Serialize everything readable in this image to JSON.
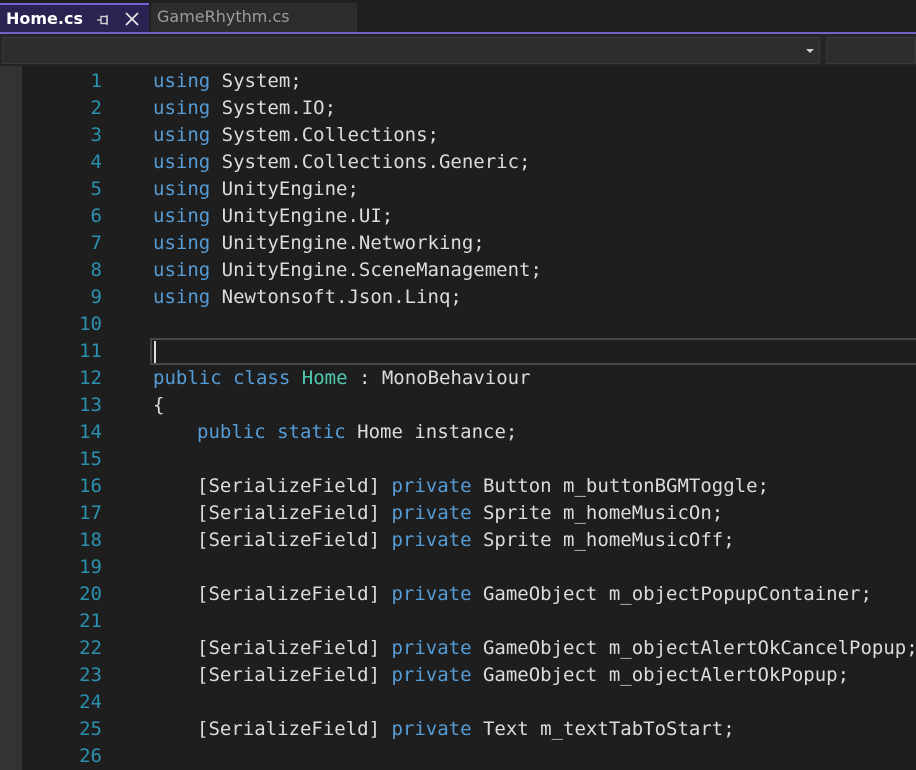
{
  "tabs": [
    {
      "label": "Home.cs",
      "active": true
    },
    {
      "label": "GameRhythm.cs",
      "active": false
    }
  ],
  "icons": {
    "pin": "pin-icon",
    "close": "close-icon",
    "dropdown": "chevron-down-icon"
  },
  "colors": {
    "accent": "#7160c6",
    "keyword": "#569cd6",
    "type": "#4ec9b0",
    "text": "#dcdcdc",
    "line_number": "#2b91af"
  },
  "editor": {
    "current_line": 11,
    "lines": [
      {
        "num": "1",
        "indent": 0,
        "tokens": [
          {
            "t": "using",
            "c": "kw"
          },
          {
            "t": " System;",
            "c": ""
          }
        ]
      },
      {
        "num": "2",
        "indent": 0,
        "tokens": [
          {
            "t": "using",
            "c": "kw"
          },
          {
            "t": " System.IO;",
            "c": ""
          }
        ]
      },
      {
        "num": "3",
        "indent": 0,
        "tokens": [
          {
            "t": "using",
            "c": "kw"
          },
          {
            "t": " System.Collections;",
            "c": ""
          }
        ]
      },
      {
        "num": "4",
        "indent": 0,
        "tokens": [
          {
            "t": "using",
            "c": "kw"
          },
          {
            "t": " System.Collections.Generic;",
            "c": ""
          }
        ]
      },
      {
        "num": "5",
        "indent": 0,
        "tokens": [
          {
            "t": "using",
            "c": "kw"
          },
          {
            "t": " UnityEngine;",
            "c": ""
          }
        ]
      },
      {
        "num": "6",
        "indent": 0,
        "tokens": [
          {
            "t": "using",
            "c": "kw"
          },
          {
            "t": " UnityEngine.UI;",
            "c": ""
          }
        ]
      },
      {
        "num": "7",
        "indent": 0,
        "tokens": [
          {
            "t": "using",
            "c": "kw"
          },
          {
            "t": " UnityEngine.Networking;",
            "c": ""
          }
        ]
      },
      {
        "num": "8",
        "indent": 0,
        "tokens": [
          {
            "t": "using",
            "c": "kw"
          },
          {
            "t": " UnityEngine.SceneManagement;",
            "c": ""
          }
        ]
      },
      {
        "num": "9",
        "indent": 0,
        "tokens": [
          {
            "t": "using",
            "c": "kw"
          },
          {
            "t": " Newtonsoft.Json.Linq;",
            "c": ""
          }
        ]
      },
      {
        "num": "10",
        "indent": 0,
        "tokens": []
      },
      {
        "num": "11",
        "indent": 0,
        "tokens": []
      },
      {
        "num": "12",
        "indent": 0,
        "tokens": [
          {
            "t": "public",
            "c": "kw"
          },
          {
            "t": " ",
            "c": ""
          },
          {
            "t": "class",
            "c": "kw"
          },
          {
            "t": " ",
            "c": ""
          },
          {
            "t": "Home",
            "c": "ty"
          },
          {
            "t": " : MonoBehaviour",
            "c": ""
          }
        ]
      },
      {
        "num": "13",
        "indent": 0,
        "tokens": [
          {
            "t": "{",
            "c": ""
          }
        ]
      },
      {
        "num": "14",
        "indent": 1,
        "tokens": [
          {
            "t": "public",
            "c": "kw"
          },
          {
            "t": " ",
            "c": ""
          },
          {
            "t": "static",
            "c": "kw"
          },
          {
            "t": " Home instance;",
            "c": ""
          }
        ]
      },
      {
        "num": "15",
        "indent": 1,
        "tokens": []
      },
      {
        "num": "16",
        "indent": 1,
        "tokens": [
          {
            "t": "[SerializeField] ",
            "c": ""
          },
          {
            "t": "private",
            "c": "kw"
          },
          {
            "t": " Button m_buttonBGMToggle;",
            "c": ""
          }
        ]
      },
      {
        "num": "17",
        "indent": 1,
        "tokens": [
          {
            "t": "[SerializeField] ",
            "c": ""
          },
          {
            "t": "private",
            "c": "kw"
          },
          {
            "t": " Sprite m_homeMusicOn;",
            "c": ""
          }
        ]
      },
      {
        "num": "18",
        "indent": 1,
        "tokens": [
          {
            "t": "[SerializeField] ",
            "c": ""
          },
          {
            "t": "private",
            "c": "kw"
          },
          {
            "t": " Sprite m_homeMusicOff;",
            "c": ""
          }
        ]
      },
      {
        "num": "19",
        "indent": 1,
        "tokens": []
      },
      {
        "num": "20",
        "indent": 1,
        "tokens": [
          {
            "t": "[SerializeField] ",
            "c": ""
          },
          {
            "t": "private",
            "c": "kw"
          },
          {
            "t": " GameObject m_objectPopupContainer;",
            "c": ""
          }
        ]
      },
      {
        "num": "21",
        "indent": 1,
        "tokens": []
      },
      {
        "num": "22",
        "indent": 1,
        "tokens": [
          {
            "t": "[SerializeField] ",
            "c": ""
          },
          {
            "t": "private",
            "c": "kw"
          },
          {
            "t": " GameObject m_objectAlertOkCancelPopup;",
            "c": ""
          }
        ]
      },
      {
        "num": "23",
        "indent": 1,
        "tokens": [
          {
            "t": "[SerializeField] ",
            "c": ""
          },
          {
            "t": "private",
            "c": "kw"
          },
          {
            "t": " GameObject m_objectAlertOkPopup;",
            "c": ""
          }
        ]
      },
      {
        "num": "24",
        "indent": 1,
        "tokens": []
      },
      {
        "num": "25",
        "indent": 1,
        "tokens": [
          {
            "t": "[SerializeField] ",
            "c": ""
          },
          {
            "t": "private",
            "c": "kw"
          },
          {
            "t": " Text m_textTabToStart;",
            "c": ""
          }
        ]
      },
      {
        "num": "26",
        "indent": 1,
        "tokens": []
      }
    ]
  }
}
